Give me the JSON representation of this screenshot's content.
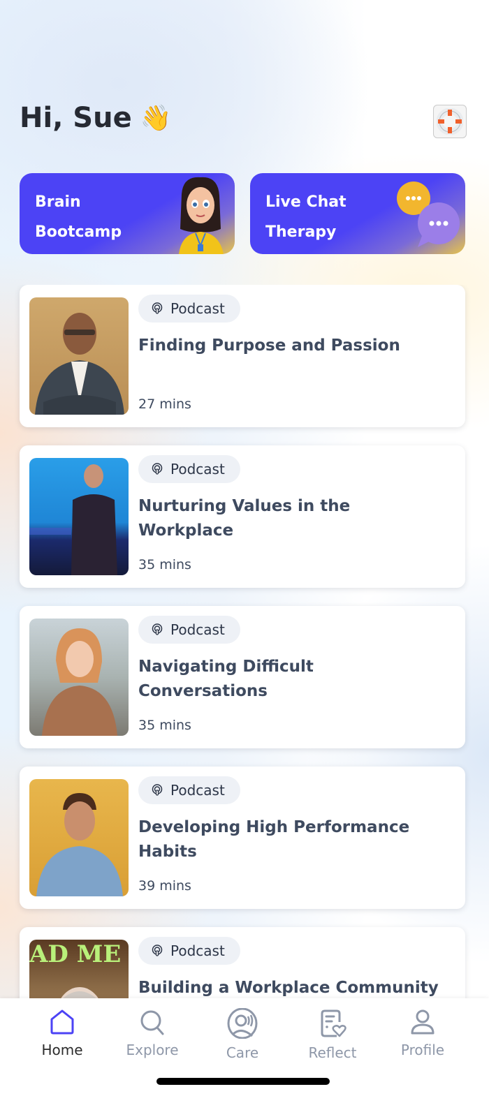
{
  "header": {
    "greeting": "Hi, Sue",
    "wave_emoji": "👋",
    "help_icon": "lifebuoy-icon"
  },
  "promos": [
    {
      "line1": "Brain",
      "line2": "Bootcamp",
      "icon": "avatar-character-illustration"
    },
    {
      "line1": "Live Chat",
      "line2": "Therapy",
      "icon": "chat-bubbles-illustration"
    }
  ],
  "colors": {
    "accent": "#4c43f5",
    "text_dark": "#262a33",
    "card_text": "#3e4a5f",
    "tab_inactive": "#8e97a8",
    "pill_bg": "#eef1f6"
  },
  "podcasts": [
    {
      "type": "Podcast",
      "title": "Finding Purpose and Passion",
      "duration": "27 mins",
      "thumb": "man-in-suit-photo"
    },
    {
      "type": "Podcast",
      "title": "Nurturing Values in the Workplace",
      "duration": "35 mins",
      "thumb": "speaker-on-stage-photo"
    },
    {
      "type": "Podcast",
      "title": "Navigating Difficult Conversations",
      "duration": "35 mins",
      "thumb": "woman-smiling-photo"
    },
    {
      "type": "Podcast",
      "title": "Developing High Performance Habits",
      "duration": "39 mins",
      "thumb": "man-in-denim-shirt-photo"
    },
    {
      "type": "Podcast",
      "title": "Building a Workplace Community",
      "duration": "",
      "thumb": "man-with-neon-sign-photo"
    }
  ],
  "tabbar": {
    "items": [
      {
        "label": "Home",
        "icon": "home-icon",
        "active": true
      },
      {
        "label": "Explore",
        "icon": "search-icon",
        "active": false
      },
      {
        "label": "Care",
        "icon": "care-icon",
        "active": false
      },
      {
        "label": "Reflect",
        "icon": "reflect-journal-icon",
        "active": false
      },
      {
        "label": "Profile",
        "icon": "profile-icon",
        "active": false
      }
    ]
  }
}
